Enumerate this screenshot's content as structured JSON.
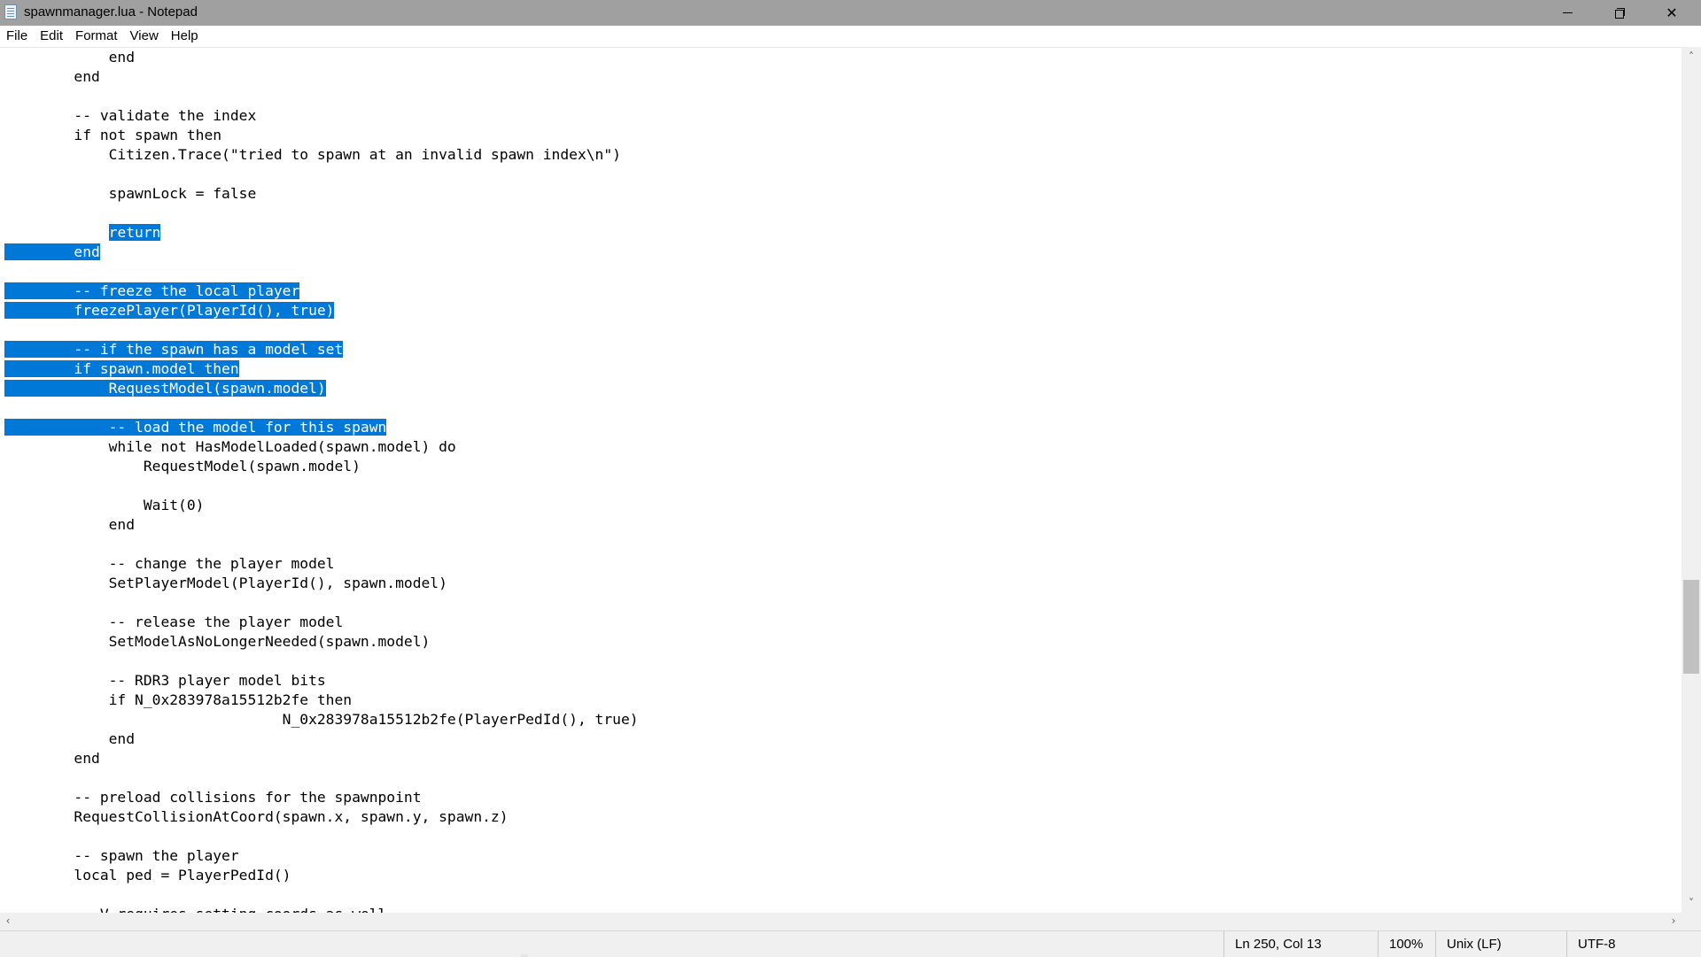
{
  "window": {
    "title": "spawnmanager.lua - Notepad",
    "minimize_label": "Minimize",
    "maximize_label": "Restore",
    "close_label": "✕"
  },
  "menu": [
    "File",
    "Edit",
    "Format",
    "View",
    "Help"
  ],
  "editor": {
    "lines": [
      {
        "pre": "            end",
        "sel": "",
        "post": ""
      },
      {
        "pre": "        end",
        "sel": "",
        "post": ""
      },
      {
        "pre": "",
        "sel": "",
        "post": ""
      },
      {
        "pre": "        -- validate the index",
        "sel": "",
        "post": ""
      },
      {
        "pre": "        if not spawn then",
        "sel": "",
        "post": ""
      },
      {
        "pre": "            Citizen.Trace(\"tried to spawn at an invalid spawn index\\n\")",
        "sel": "",
        "post": ""
      },
      {
        "pre": "",
        "sel": "",
        "post": ""
      },
      {
        "pre": "            spawnLock = false",
        "sel": "",
        "post": ""
      },
      {
        "pre": "",
        "sel": "",
        "post": ""
      },
      {
        "pre": "            ",
        "sel": "return",
        "post": ""
      },
      {
        "pre": "",
        "sel": "        end",
        "post": ""
      },
      {
        "pre": "",
        "sel": "",
        "post": ""
      },
      {
        "pre": "",
        "sel": "        -- freeze the local player",
        "post": ""
      },
      {
        "pre": "",
        "sel": "        freezePlayer(PlayerId(), true)",
        "post": ""
      },
      {
        "pre": "",
        "sel": "",
        "post": ""
      },
      {
        "pre": "",
        "sel": "        -- if the spawn has a model set",
        "post": ""
      },
      {
        "pre": "",
        "sel": "        if spawn.model then",
        "post": ""
      },
      {
        "pre": "",
        "sel": "            RequestModel(spawn.model)",
        "post": ""
      },
      {
        "pre": "",
        "sel": "",
        "post": ""
      },
      {
        "pre": "",
        "sel": "            -- load the model for this spawn",
        "post": ""
      },
      {
        "pre": "            while not HasModelLoaded(spawn.model) do",
        "sel": "",
        "post": ""
      },
      {
        "pre": "                RequestModel(spawn.model)",
        "sel": "",
        "post": ""
      },
      {
        "pre": "",
        "sel": "",
        "post": ""
      },
      {
        "pre": "                Wait(0)",
        "sel": "",
        "post": ""
      },
      {
        "pre": "            end",
        "sel": "",
        "post": ""
      },
      {
        "pre": "",
        "sel": "",
        "post": ""
      },
      {
        "pre": "            -- change the player model",
        "sel": "",
        "post": ""
      },
      {
        "pre": "            SetPlayerModel(PlayerId(), spawn.model)",
        "sel": "",
        "post": ""
      },
      {
        "pre": "",
        "sel": "",
        "post": ""
      },
      {
        "pre": "            -- release the player model",
        "sel": "",
        "post": ""
      },
      {
        "pre": "            SetModelAsNoLongerNeeded(spawn.model)",
        "sel": "",
        "post": ""
      },
      {
        "pre": "",
        "sel": "",
        "post": ""
      },
      {
        "pre": "            -- RDR3 player model bits",
        "sel": "",
        "post": ""
      },
      {
        "pre": "            if N_0x283978a15512b2fe then",
        "sel": "",
        "post": ""
      },
      {
        "pre": "\t\t\t\tN_0x283978a15512b2fe(PlayerPedId(), true)",
        "sel": "",
        "post": ""
      },
      {
        "pre": "            end",
        "sel": "",
        "post": ""
      },
      {
        "pre": "        end",
        "sel": "",
        "post": ""
      },
      {
        "pre": "",
        "sel": "",
        "post": ""
      },
      {
        "pre": "        -- preload collisions for the spawnpoint",
        "sel": "",
        "post": ""
      },
      {
        "pre": "        RequestCollisionAtCoord(spawn.x, spawn.y, spawn.z)",
        "sel": "",
        "post": ""
      },
      {
        "pre": "",
        "sel": "",
        "post": ""
      },
      {
        "pre": "        -- spawn the player",
        "sel": "",
        "post": ""
      },
      {
        "pre": "        local ped = PlayerPedId()",
        "sel": "",
        "post": ""
      },
      {
        "pre": "",
        "sel": "",
        "post": ""
      },
      {
        "pre": "        -- V requires setting coords as well",
        "sel": "",
        "post": ""
      }
    ]
  },
  "statusbar": {
    "position": "Ln 250, Col 13",
    "zoom": "100%",
    "line_ending": "Unix (LF)",
    "encoding": "UTF-8"
  },
  "colors": {
    "selection": "#0078d7",
    "titlebar": "#a0a0a0"
  }
}
